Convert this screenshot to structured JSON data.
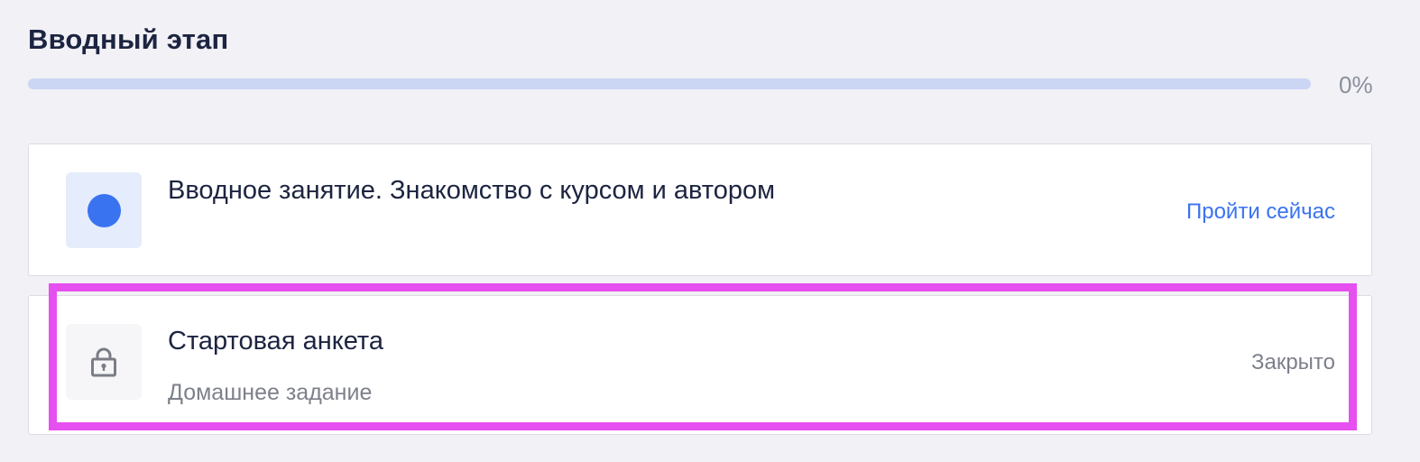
{
  "stage": {
    "title": "Вводный этап",
    "progress_percent": 0,
    "progress_label": "0%"
  },
  "lessons": [
    {
      "title": "Вводное занятие. Знакомство с курсом и автором",
      "subtitle": "",
      "action_label": "Пройти сейчас",
      "icon": "dot-icon",
      "status": "available"
    },
    {
      "title": "Стартовая анкета",
      "subtitle": "Домашнее задание",
      "action_label": "Закрыто",
      "icon": "lock-icon",
      "status": "locked"
    }
  ],
  "colors": {
    "accent": "#3a73f0",
    "progress_track": "#cbd6f5",
    "highlight": "#e64ff0",
    "text_primary": "#1c2440",
    "text_muted": "#7d808b"
  }
}
